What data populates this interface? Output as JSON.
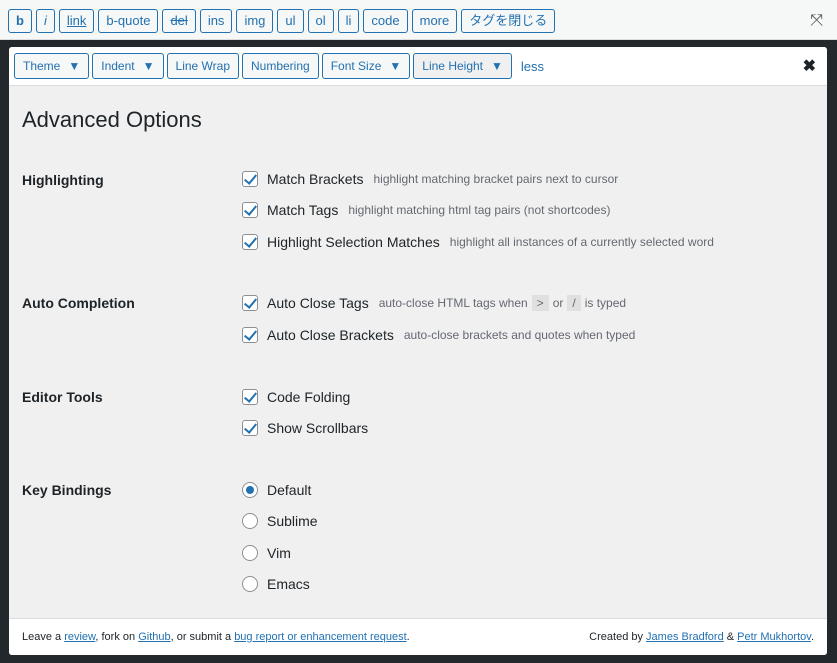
{
  "quicktags": {
    "buttons": [
      "b",
      "i",
      "link",
      "b-quote",
      "del",
      "ins",
      "img",
      "ul",
      "ol",
      "li",
      "code",
      "more",
      "タグを閉じる"
    ],
    "fullscreen_icon": "fullscreen-icon"
  },
  "panel": {
    "toolbar": {
      "theme": "Theme",
      "indent": "Indent",
      "line_wrap": "Line Wrap",
      "numbering": "Numbering",
      "font_size": "Font Size",
      "line_height": "Line Height",
      "less": "less",
      "close": "✖"
    },
    "title": "Advanced Options",
    "sections": {
      "highlighting": "Highlighting",
      "auto_completion": "Auto Completion",
      "editor_tools": "Editor Tools",
      "key_bindings": "Key Bindings"
    },
    "options": {
      "match_brackets": {
        "label": "Match Brackets",
        "desc": "highlight matching bracket pairs next to cursor",
        "checked": true
      },
      "match_tags": {
        "label": "Match Tags",
        "desc": "highlight matching html tag pairs (not shortcodes)",
        "checked": true
      },
      "highlight_selection": {
        "label": "Highlight Selection Matches",
        "desc": "highlight all instances of a currently selected word",
        "checked": true
      },
      "auto_close_tags": {
        "label": "Auto Close Tags",
        "desc_pre": "auto-close HTML tags when",
        "key1": ">",
        "or": "or",
        "key2": "/",
        "desc_post": "is typed",
        "checked": true
      },
      "auto_close_brackets": {
        "label": "Auto Close Brackets",
        "desc": "auto-close brackets and quotes when typed",
        "checked": true
      },
      "code_folding": {
        "label": "Code Folding",
        "checked": true
      },
      "show_scrollbars": {
        "label": "Show Scrollbars",
        "checked": true
      }
    },
    "key_bindings": {
      "options": [
        "Default",
        "Sublime",
        "Vim",
        "Emacs"
      ],
      "selected": "Default"
    },
    "footer": {
      "t1": "Leave a ",
      "review": "review",
      "t2": ", fork on ",
      "github": "Github",
      "t3": ", or submit a ",
      "bug": "bug report or enhancement request",
      "t4": ".",
      "created": "Created by ",
      "author1": "James Bradford",
      "amp": " & ",
      "author2": "Petr Mukhortov",
      "end": "."
    }
  },
  "colors": {
    "accent": "#2271b1",
    "editor_bg": "#23282d",
    "panel_bg": "#f0f0f1"
  }
}
